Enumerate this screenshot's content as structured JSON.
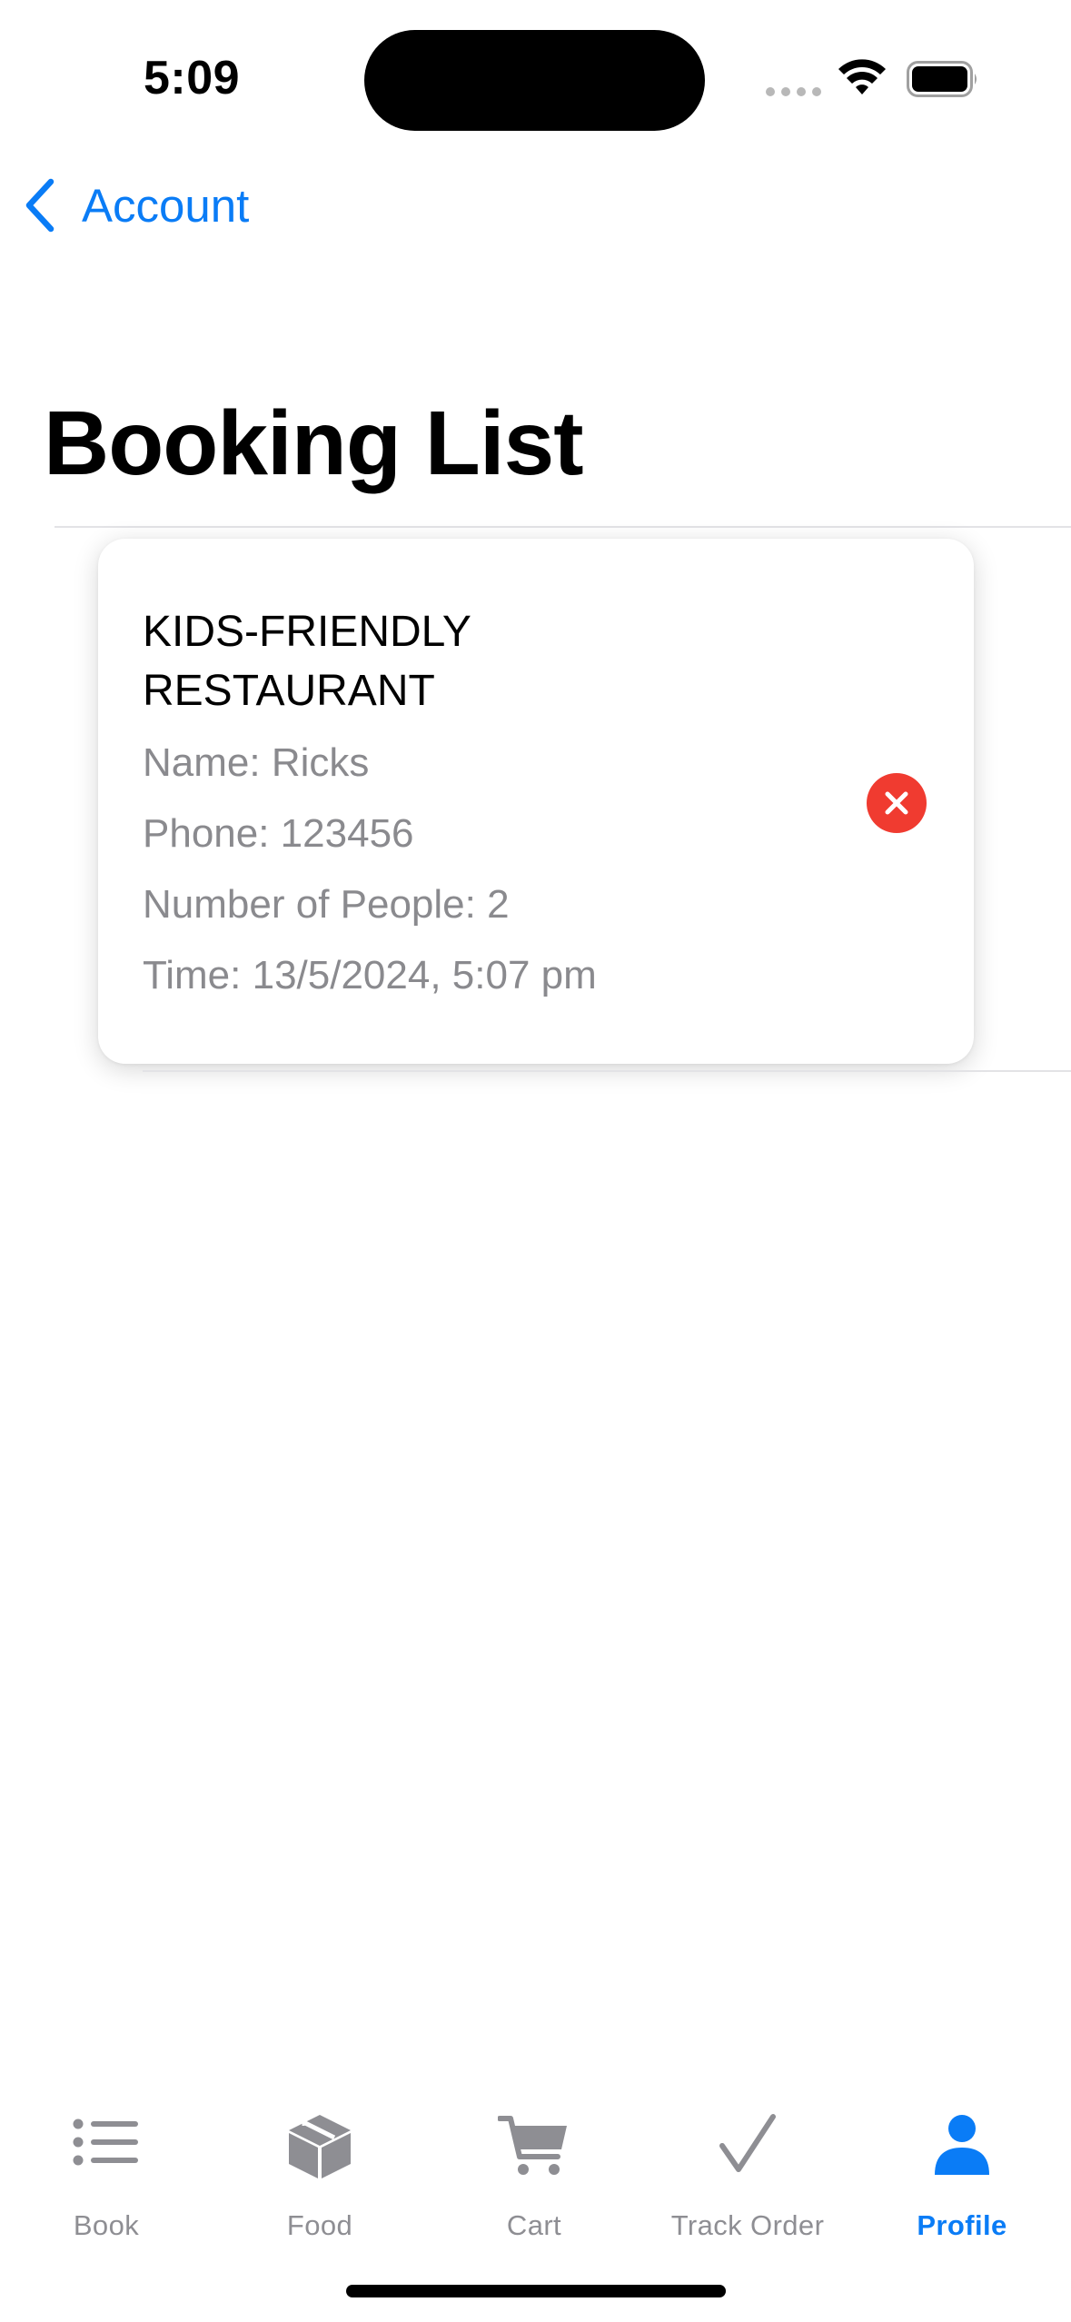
{
  "status_bar": {
    "time": "5:09"
  },
  "nav": {
    "back_label": "Account",
    "accent_color": "#0a7cf6"
  },
  "page": {
    "title": "Booking List"
  },
  "booking": {
    "restaurant": "KIDS-FRIENDLY RESTAURANT",
    "name_line": "Name: Ricks",
    "phone_line": "Phone: 123456",
    "people_line": "Number of People: 2",
    "time_line": "Time: 13/5/2024, 5:07 pm",
    "delete_icon": "xmark-circle-icon",
    "delete_color": "#f03b30"
  },
  "tab_bar": {
    "active": "Profile",
    "tabs": [
      {
        "label": "Book",
        "icon": "list-icon"
      },
      {
        "label": "Food",
        "icon": "box-icon"
      },
      {
        "label": "Cart",
        "icon": "cart-icon"
      },
      {
        "label": "Track Order",
        "icon": "checkmark-icon"
      },
      {
        "label": "Profile",
        "icon": "person-icon"
      }
    ]
  }
}
